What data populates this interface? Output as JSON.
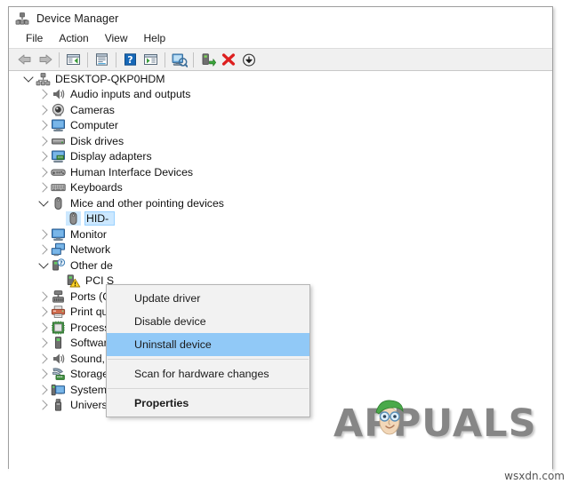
{
  "window": {
    "title": "Device Manager",
    "title_icon": "device-manager-icon"
  },
  "menubar": {
    "items": [
      {
        "label": "File"
      },
      {
        "label": "Action"
      },
      {
        "label": "View"
      },
      {
        "label": "Help"
      }
    ]
  },
  "toolbar": {
    "buttons": [
      {
        "name": "back-arrow-icon",
        "tooltip": "Back"
      },
      {
        "name": "forward-arrow-icon",
        "tooltip": "Forward"
      },
      {
        "name": "separator-1"
      },
      {
        "name": "show-hide-console-tree-icon",
        "tooltip": "Show/Hide Console Tree"
      },
      {
        "name": "separator-2"
      },
      {
        "name": "properties-icon",
        "tooltip": "Properties"
      },
      {
        "name": "separator-3"
      },
      {
        "name": "help-icon",
        "tooltip": "Help"
      },
      {
        "name": "view-icon",
        "tooltip": "View"
      },
      {
        "name": "separator-4"
      },
      {
        "name": "scan-for-hardware-changes-icon",
        "tooltip": "Scan for hardware changes"
      },
      {
        "name": "separator-5"
      },
      {
        "name": "update-driver-icon",
        "tooltip": "Update driver"
      },
      {
        "name": "uninstall-device-icon",
        "tooltip": "Uninstall device"
      },
      {
        "name": "disable-device-icon",
        "tooltip": "Disable device"
      }
    ]
  },
  "tree": {
    "root": {
      "label": "DESKTOP-QKP0HDM",
      "icon": "computer-root-icon",
      "expanded": true,
      "indent": 0
    },
    "nodes": [
      {
        "label": "Audio inputs and outputs",
        "icon": "speaker-icon",
        "state": "collapsed",
        "indent": 1
      },
      {
        "label": "Cameras",
        "icon": "camera-icon",
        "state": "collapsed",
        "indent": 1
      },
      {
        "label": "Computer",
        "icon": "monitor-icon",
        "state": "collapsed",
        "indent": 1
      },
      {
        "label": "Disk drives",
        "icon": "disk-drive-icon",
        "state": "collapsed",
        "indent": 1
      },
      {
        "label": "Display adapters",
        "icon": "display-adapter-icon",
        "state": "collapsed",
        "indent": 1
      },
      {
        "label": "Human Interface Devices",
        "icon": "hid-icon",
        "state": "collapsed",
        "indent": 1
      },
      {
        "label": "Keyboards",
        "icon": "keyboard-icon",
        "state": "collapsed",
        "indent": 1
      },
      {
        "label": "Mice and other pointing devices",
        "icon": "mouse-icon",
        "state": "expanded",
        "indent": 1
      },
      {
        "label": "HID-",
        "icon": "mouse-icon",
        "state": "leaf",
        "indent": 2,
        "selected": true
      },
      {
        "label": "Monitor",
        "icon": "monitor-icon",
        "state": "collapsed",
        "indent": 1
      },
      {
        "label": "Network",
        "icon": "network-adapter-icon",
        "state": "collapsed",
        "indent": 1
      },
      {
        "label": "Other de",
        "icon": "other-devices-icon",
        "state": "expanded",
        "indent": 1
      },
      {
        "label": "PCI S",
        "icon": "unknown-device-warning-icon",
        "state": "leaf",
        "indent": 2
      },
      {
        "label": "Ports (C",
        "icon": "port-icon",
        "state": "collapsed",
        "indent": 1
      },
      {
        "label": "Print qu",
        "icon": "printer-icon",
        "state": "collapsed",
        "indent": 1
      },
      {
        "label": "Processors",
        "icon": "processor-icon",
        "state": "collapsed",
        "indent": 1
      },
      {
        "label": "Software devices",
        "icon": "software-device-icon",
        "state": "collapsed",
        "indent": 1
      },
      {
        "label": "Sound, video and game controllers",
        "icon": "speaker-icon",
        "state": "collapsed",
        "indent": 1
      },
      {
        "label": "Storage controllers",
        "icon": "storage-controller-icon",
        "state": "collapsed",
        "indent": 1
      },
      {
        "label": "System devices",
        "icon": "system-device-icon",
        "state": "collapsed",
        "indent": 1
      },
      {
        "label": "Universal Serial Bus controllers",
        "icon": "usb-controller-icon",
        "state": "collapsed",
        "indent": 1
      }
    ]
  },
  "context_menu": {
    "items": [
      {
        "label": "Update driver",
        "highlighted": false,
        "bold": false
      },
      {
        "label": "Disable device",
        "highlighted": false,
        "bold": false
      },
      {
        "label": "Uninstall device",
        "highlighted": true,
        "bold": false
      },
      {
        "separator": true
      },
      {
        "label": "Scan for hardware changes",
        "highlighted": false,
        "bold": false
      },
      {
        "separator": true
      },
      {
        "label": "Properties",
        "highlighted": false,
        "bold": true
      }
    ]
  },
  "watermark": {
    "text": "APPUALS",
    "credit": "wsxdn.com"
  },
  "colors": {
    "selection_blue": "#cce8ff",
    "menu_highlight": "#91c9f7",
    "toolbar_bg": "#f0f0f0",
    "menu_bg": "#f2f2f2",
    "warning_yellow": "#ffd42a",
    "error_red": "#e02020"
  }
}
